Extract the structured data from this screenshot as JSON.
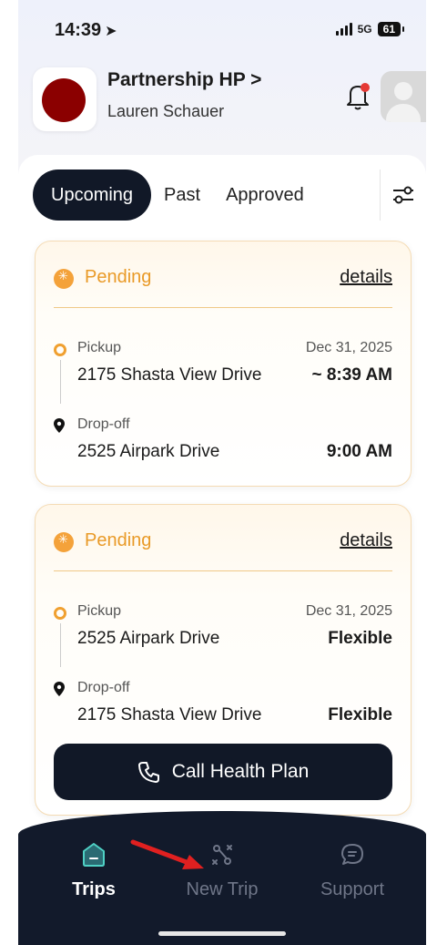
{
  "status_bar": {
    "time": "14:39",
    "network": "5G",
    "battery": "61"
  },
  "header": {
    "org_name": "Partnership HP >",
    "member_name": "Lauren Schauer"
  },
  "tabs": [
    {
      "label": "Upcoming",
      "active": true
    },
    {
      "label": "Past",
      "active": false
    },
    {
      "label": "Approved",
      "active": false
    }
  ],
  "trips": [
    {
      "status": "Pending",
      "details_link": "details",
      "pickup": {
        "label": "Pickup",
        "address": "2175 Shasta View Drive",
        "date": "Dec 31, 2025",
        "time": "~ 8:39 AM"
      },
      "dropoff": {
        "label": "Drop-off",
        "address": "2525 Airpark Drive",
        "time": "9:00 AM"
      }
    },
    {
      "status": "Pending",
      "details_link": "details",
      "pickup": {
        "label": "Pickup",
        "address": "2525 Airpark Drive",
        "date": "Dec 31, 2025",
        "time": "Flexible"
      },
      "dropoff": {
        "label": "Drop-off",
        "address": "2175 Shasta View Drive",
        "time": "Flexible"
      },
      "call_button": "Call Health Plan"
    }
  ],
  "bottom_nav": [
    {
      "label": "Trips",
      "icon": "trips-icon",
      "active": true
    },
    {
      "label": "New Trip",
      "icon": "route-icon",
      "active": false
    },
    {
      "label": "Support",
      "icon": "chat-icon",
      "active": false
    }
  ],
  "colors": {
    "accent_orange": "#f4a23a",
    "nav_dark": "#121a2b",
    "tab_active": "#111827",
    "active_icon_teal": "#4fd1c5",
    "annotation_red": "#e02020"
  }
}
